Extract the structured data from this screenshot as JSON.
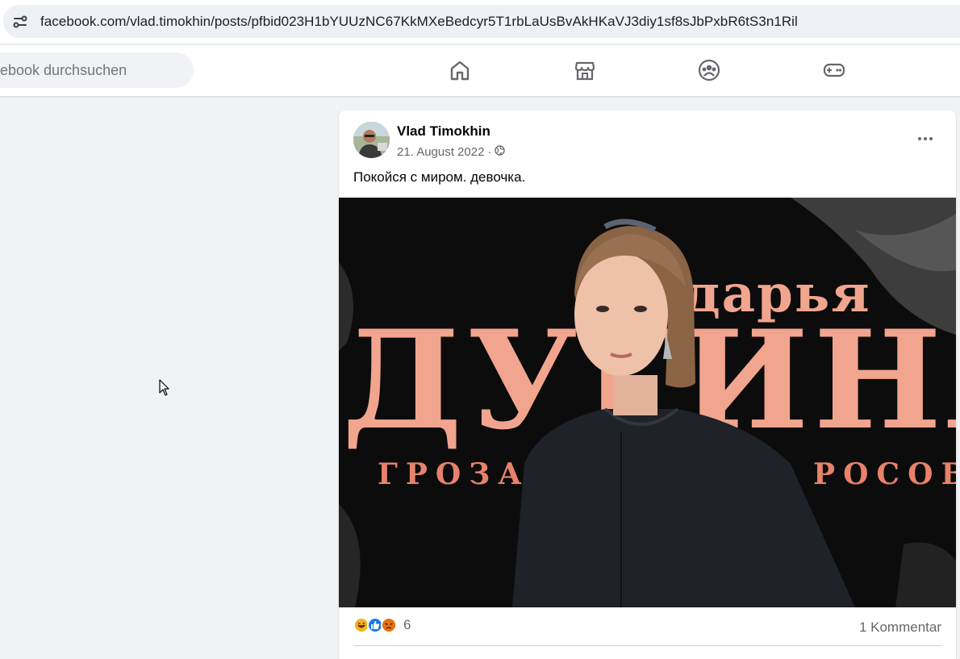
{
  "browser": {
    "url": "facebook.com/vlad.timokhin/posts/pfbid023H1bYUUzNC67KkMXeBedcyr5T1rbLaUsBvAkHKaVJ3diy1sf8sJbPxbR6tS3n1Ril"
  },
  "header": {
    "search_placeholder": "ebook durchsuchen",
    "nav_icons": [
      "home-icon",
      "marketplace-icon",
      "groups-icon",
      "gaming-icon"
    ]
  },
  "post": {
    "author": "Vlad Timokhin",
    "date": "21. August 2022",
    "separator": "·",
    "audience_icon": "globe-icon",
    "text": "Покойся с миром. девочка.",
    "image_text": {
      "top_word": "дарья",
      "main_word": "ДУГИНА",
      "subtitle_left": "ГРОЗА",
      "subtitle_right": "РОСОВ"
    },
    "reactions": [
      "haha",
      "like",
      "angry"
    ],
    "reaction_count": "6",
    "comment_count": "1 Kommentar"
  },
  "colors": {
    "facebook_blue": "#1877f2",
    "text_secondary": "#65676b",
    "background": "#f0f2f5",
    "image_title": "#f2a58e"
  }
}
